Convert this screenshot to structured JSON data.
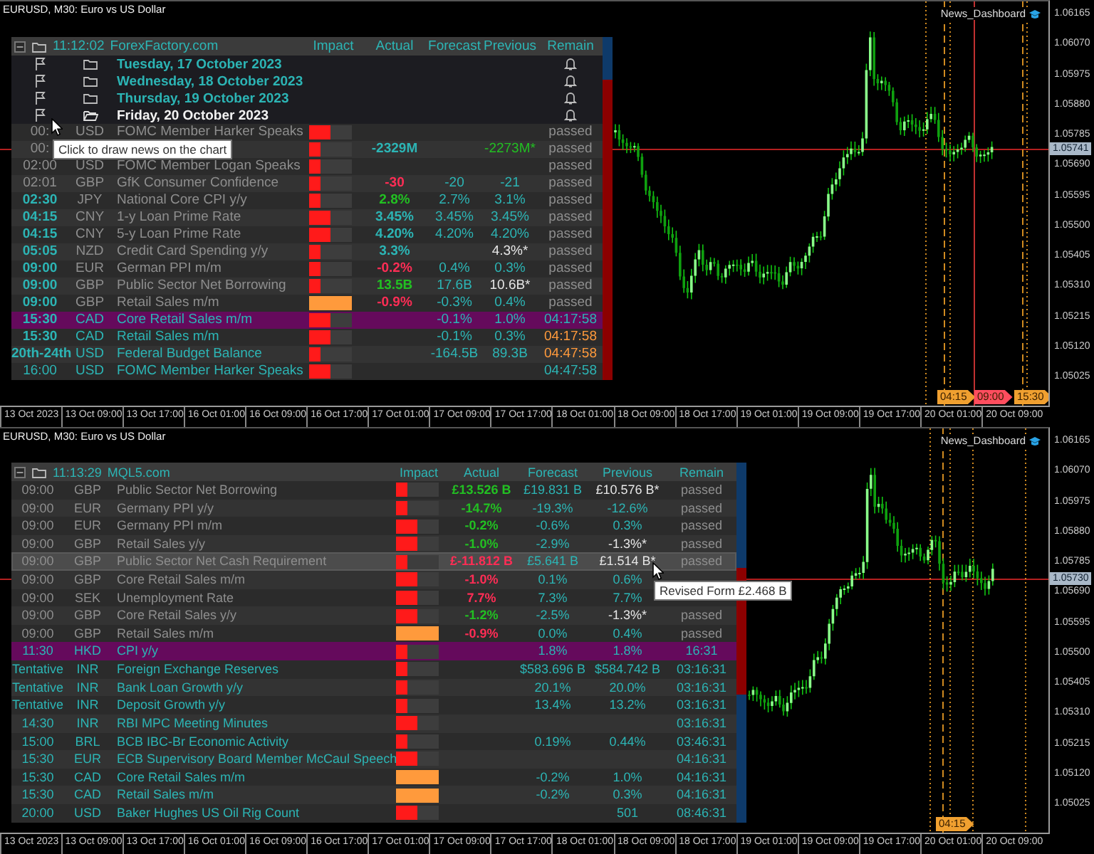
{
  "windows": [
    {
      "title": "EURUSD, M30: Euro vs US Dollar",
      "indicator": "News_Dashboard",
      "price_labels": [
        "1.06165",
        "1.06070",
        "1.05975",
        "1.05880",
        "1.05785",
        "1.05690",
        "1.05595",
        "1.05500",
        "1.05405",
        "1.05310",
        "1.05215",
        "1.05120",
        "1.05025"
      ],
      "current_price": "1.05741",
      "time_labels": [
        "13 Oct 2023",
        "13 Oct 09:00",
        "13 Oct 17:00",
        "16 Oct 01:00",
        "16 Oct 09:00",
        "16 Oct 17:00",
        "17 Oct 01:00",
        "17 Oct 09:00",
        "17 Oct 17:00",
        "18 Oct 01:00",
        "18 Oct 09:00",
        "18 Oct 17:00",
        "19 Oct 01:00",
        "19 Oct 09:00",
        "19 Oct 17:00",
        "20 Oct 01:00",
        "20 Oct 09:00"
      ],
      "event_tags": [
        {
          "label": "04:15",
          "color": "#f0a030"
        },
        {
          "label": "09:00",
          "color": "#ff4d5e"
        },
        {
          "label": "15:30",
          "color": "#f0a030"
        }
      ],
      "dashboard": {
        "collapse": "−",
        "time": "11:12:02",
        "source": "ForexFactory.com",
        "columns": [
          "Impact",
          "Actual",
          "Forecast",
          "Previous",
          "Remain"
        ],
        "days": [
          {
            "label": "Tuesday, 17 October 2023",
            "expanded": false
          },
          {
            "label": "Wednesday, 18 October 2023",
            "expanded": false
          },
          {
            "label": "Thursday, 19 October 2023",
            "expanded": false
          },
          {
            "label": "Friday, 20 October 2023",
            "expanded": true
          }
        ],
        "events": [
          {
            "time": "00:",
            "currency": "USD",
            "title": "FOMC Member Harker Speaks",
            "impact": {
              "level": 0.5,
              "color": "#ff1a1a"
            },
            "remain": {
              "text": "passed",
              "color": "#8e8e8e"
            },
            "passed": true,
            "time_bold": false,
            "highlighted": false,
            "hovered": false
          },
          {
            "time": "00:",
            "impact": {
              "level": 0.25,
              "color": "#ff1a1a"
            },
            "actual": {
              "text": "-2329M",
              "color": "#2cb5b5"
            },
            "previous": {
              "text": "-2273M*",
              "color": "#22c022"
            },
            "remain": {
              "text": "passed",
              "color": "#8e8e8e"
            },
            "passed": true,
            "time_bold": false,
            "highlighted": false,
            "hovered": false
          },
          {
            "time": "02:00",
            "currency": "USD",
            "title": "FOMC Member Logan Speaks",
            "impact": {
              "level": 0.25,
              "color": "#ff1a1a"
            },
            "remain": {
              "text": "passed",
              "color": "#8e8e8e"
            },
            "passed": true,
            "time_bold": false,
            "highlighted": false,
            "hovered": false
          },
          {
            "time": "02:01",
            "currency": "GBP",
            "title": "GfK Consumer Confidence",
            "impact": {
              "level": 0.25,
              "color": "#ff1a1a"
            },
            "actual": {
              "text": "-30",
              "color": "#ff2d55"
            },
            "forecast": {
              "text": "-20",
              "color": "#2cb5b5"
            },
            "previous": {
              "text": "-21",
              "color": "#2cb5b5"
            },
            "remain": {
              "text": "passed",
              "color": "#8e8e8e"
            },
            "passed": true,
            "time_bold": false,
            "highlighted": false,
            "hovered": false
          },
          {
            "time": "02:30",
            "currency": "JPY",
            "title": "National Core CPI y/y",
            "impact": {
              "level": 0.25,
              "color": "#ff1a1a"
            },
            "actual": {
              "text": "2.8%",
              "color": "#22c022"
            },
            "forecast": {
              "text": "2.7%",
              "color": "#2cb5b5"
            },
            "previous": {
              "text": "3.1%",
              "color": "#2cb5b5"
            },
            "remain": {
              "text": "passed",
              "color": "#8e8e8e"
            },
            "passed": true,
            "time_bold": true,
            "highlighted": false,
            "hovered": false
          },
          {
            "time": "04:15",
            "currency": "CNY",
            "title": "1-y Loan Prime Rate",
            "impact": {
              "level": 0.5,
              "color": "#ff1a1a"
            },
            "actual": {
              "text": "3.45%",
              "color": "#2cb5b5"
            },
            "forecast": {
              "text": "3.45%",
              "color": "#2cb5b5"
            },
            "previous": {
              "text": "3.45%",
              "color": "#2cb5b5"
            },
            "remain": {
              "text": "passed",
              "color": "#8e8e8e"
            },
            "passed": true,
            "time_bold": true,
            "highlighted": false,
            "hovered": false
          },
          {
            "time": "04:15",
            "currency": "CNY",
            "title": "5-y Loan Prime Rate",
            "impact": {
              "level": 0.5,
              "color": "#ff1a1a"
            },
            "actual": {
              "text": "4.20%",
              "color": "#2cb5b5"
            },
            "forecast": {
              "text": "4.20%",
              "color": "#2cb5b5"
            },
            "previous": {
              "text": "4.20%",
              "color": "#2cb5b5"
            },
            "remain": {
              "text": "passed",
              "color": "#8e8e8e"
            },
            "passed": true,
            "time_bold": true,
            "highlighted": false,
            "hovered": false
          },
          {
            "time": "05:05",
            "currency": "NZD",
            "title": "Credit Card Spending y/y",
            "impact": {
              "level": 0.25,
              "color": "#ff1a1a"
            },
            "actual": {
              "text": "3.3%",
              "color": "#2cb5b5"
            },
            "previous": {
              "text": "4.3%*",
              "color": "#e6e6e6"
            },
            "remain": {
              "text": "passed",
              "color": "#8e8e8e"
            },
            "passed": true,
            "time_bold": true,
            "highlighted": false,
            "hovered": false
          },
          {
            "time": "09:00",
            "currency": "EUR",
            "title": "German PPI m/m",
            "impact": {
              "level": 0.25,
              "color": "#ff1a1a"
            },
            "actual": {
              "text": "-0.2%",
              "color": "#ff2d55"
            },
            "forecast": {
              "text": "0.4%",
              "color": "#2cb5b5"
            },
            "previous": {
              "text": "0.3%",
              "color": "#2cb5b5"
            },
            "remain": {
              "text": "passed",
              "color": "#8e8e8e"
            },
            "passed": true,
            "time_bold": true,
            "highlighted": false,
            "hovered": false
          },
          {
            "time": "09:00",
            "currency": "GBP",
            "title": "Public Sector Net Borrowing",
            "impact": {
              "level": 0.25,
              "color": "#ff1a1a"
            },
            "actual": {
              "text": "13.5B",
              "color": "#22c022"
            },
            "forecast": {
              "text": "17.6B",
              "color": "#2cb5b5"
            },
            "previous": {
              "text": "10.6B*",
              "color": "#e6e6e6"
            },
            "remain": {
              "text": "passed",
              "color": "#8e8e8e"
            },
            "passed": true,
            "time_bold": true,
            "highlighted": false,
            "hovered": false
          },
          {
            "time": "09:00",
            "currency": "GBP",
            "title": "Retail Sales m/m",
            "impact": {
              "level": 1,
              "color": "#ff9a3c"
            },
            "actual": {
              "text": "-0.9%",
              "color": "#ff2d55"
            },
            "forecast": {
              "text": "-0.3%",
              "color": "#2cb5b5"
            },
            "previous": {
              "text": "0.4%",
              "color": "#2cb5b5"
            },
            "remain": {
              "text": "passed",
              "color": "#8e8e8e"
            },
            "passed": true,
            "time_bold": true,
            "highlighted": false,
            "hovered": false
          },
          {
            "time": "15:30",
            "currency": "CAD",
            "title": "Core Retail Sales m/m",
            "impact": {
              "level": 0.5,
              "color": "#ff1a1a"
            },
            "forecast": {
              "text": "-0.1%",
              "color": "#2cb5b5"
            },
            "previous": {
              "text": "1.0%",
              "color": "#2cb5b5"
            },
            "remain": {
              "text": "04:17:58",
              "color": "#2cb5b5"
            },
            "passed": false,
            "time_bold": true,
            "highlighted": true,
            "hovered": false
          },
          {
            "time": "15:30",
            "currency": "CAD",
            "title": "Retail Sales m/m",
            "impact": {
              "level": 0.5,
              "color": "#ff1a1a"
            },
            "forecast": {
              "text": "-0.1%",
              "color": "#2cb5b5"
            },
            "previous": {
              "text": "0.3%",
              "color": "#2cb5b5"
            },
            "remain": {
              "text": "04:17:58",
              "color": "#ff9a3c"
            },
            "passed": false,
            "time_bold": true,
            "highlighted": false,
            "hovered": false
          },
          {
            "time": "20th-24th",
            "currency": "USD",
            "title": "Federal Budget Balance",
            "impact": {
              "level": 0.25,
              "color": "#ff1a1a"
            },
            "forecast": {
              "text": "-164.5B",
              "color": "#2cb5b5"
            },
            "previous": {
              "text": "89.3B",
              "color": "#2cb5b5"
            },
            "remain": {
              "text": "04:47:58",
              "color": "#ff9a3c"
            },
            "passed": false,
            "time_bold": true,
            "highlighted": false,
            "hovered": false
          },
          {
            "time": "16:00",
            "currency": "USD",
            "title": "FOMC Member Harker Speaks",
            "impact": {
              "level": 0.5,
              "color": "#ff1a1a"
            },
            "remain": {
              "text": "04:47:58",
              "color": "#2cb5b5"
            },
            "passed": false,
            "time_bold": false,
            "highlighted": false,
            "hovered": false
          }
        ],
        "tooltip": "Click to draw news on the chart"
      }
    },
    {
      "title": "EURUSD, M30: Euro vs US Dollar",
      "indicator": "News_Dashboard",
      "price_labels": [
        "1.06165",
        "1.06070",
        "1.05975",
        "1.05880",
        "1.05785",
        "1.05690",
        "1.05595",
        "1.05500",
        "1.05405",
        "1.05310",
        "1.05215",
        "1.05120",
        "1.05025"
      ],
      "current_price": "1.05730",
      "time_labels": [
        "13 Oct 2023",
        "13 Oct 09:00",
        "13 Oct 17:00",
        "16 Oct 01:00",
        "16 Oct 09:00",
        "16 Oct 17:00",
        "17 Oct 01:00",
        "17 Oct 09:00",
        "17 Oct 17:00",
        "18 Oct 01:00",
        "18 Oct 09:00",
        "18 Oct 17:00",
        "19 Oct 01:00",
        "19 Oct 09:00",
        "19 Oct 17:00",
        "20 Oct 01:00",
        "20 Oct 09:00"
      ],
      "event_tags": [
        {
          "label": "04:15",
          "color": "#f0a030"
        }
      ],
      "dashboard": {
        "collapse": "−",
        "time": "11:13:29",
        "source": "MQL5.com",
        "columns": [
          "Impact",
          "Actual",
          "Forecast",
          "Previous",
          "Remain"
        ],
        "events": [
          {
            "time": "09:00",
            "currency": "GBP",
            "title": "Public Sector Net Borrowing",
            "impact": {
              "level": 0.25,
              "color": "#ff1a1a"
            },
            "actual": {
              "text": "£13.526 B",
              "color": "#22c022"
            },
            "forecast": {
              "text": "£19.831 B",
              "color": "#2cb5b5"
            },
            "previous": {
              "text": "£10.576 B*",
              "color": "#e6e6e6"
            },
            "remain": {
              "text": "passed",
              "color": "#8e8e8e"
            },
            "passed": true,
            "time_bold": false,
            "highlighted": false,
            "hovered": false
          },
          {
            "time": "09:00",
            "currency": "EUR",
            "title": "Germany PPI y/y",
            "impact": {
              "level": 0.25,
              "color": "#ff1a1a"
            },
            "actual": {
              "text": "-14.7%",
              "color": "#22c022"
            },
            "forecast": {
              "text": "-19.3%",
              "color": "#2cb5b5"
            },
            "previous": {
              "text": "-12.6%",
              "color": "#2cb5b5"
            },
            "remain": {
              "text": "passed",
              "color": "#8e8e8e"
            },
            "passed": true,
            "time_bold": false,
            "highlighted": false,
            "hovered": false
          },
          {
            "time": "09:00",
            "currency": "EUR",
            "title": "Germany PPI m/m",
            "impact": {
              "level": 0.5,
              "color": "#ff1a1a"
            },
            "actual": {
              "text": "-0.2%",
              "color": "#22c022"
            },
            "forecast": {
              "text": "-0.6%",
              "color": "#2cb5b5"
            },
            "previous": {
              "text": "0.3%",
              "color": "#2cb5b5"
            },
            "remain": {
              "text": "passed",
              "color": "#8e8e8e"
            },
            "passed": true,
            "time_bold": false,
            "highlighted": false,
            "hovered": false
          },
          {
            "time": "09:00",
            "currency": "GBP",
            "title": "Retail Sales y/y",
            "impact": {
              "level": 0.5,
              "color": "#ff1a1a"
            },
            "actual": {
              "text": "-1.0%",
              "color": "#22c022"
            },
            "forecast": {
              "text": "-2.9%",
              "color": "#2cb5b5"
            },
            "previous": {
              "text": "-1.3%*",
              "color": "#e6e6e6"
            },
            "remain": {
              "text": "passed",
              "color": "#8e8e8e"
            },
            "passed": true,
            "time_bold": false,
            "highlighted": false,
            "hovered": false
          },
          {
            "time": "09:00",
            "currency": "GBP",
            "title": "Public Sector Net Cash Requirement",
            "impact": {
              "level": 0.25,
              "color": "#ff1a1a"
            },
            "actual": {
              "text": "£-11.812 B",
              "color": "#ff2d55"
            },
            "forecast": {
              "text": "£5.641 B",
              "color": "#2cb5b5"
            },
            "previous": {
              "text": "£1.514 B*",
              "color": "#e6e6e6"
            },
            "remain": {
              "text": "passed",
              "color": "#8e8e8e"
            },
            "passed": true,
            "time_bold": false,
            "highlighted": false,
            "hovered": true
          },
          {
            "time": "09:00",
            "currency": "GBP",
            "title": "Core Retail Sales m/m",
            "impact": {
              "level": 0.5,
              "color": "#ff1a1a"
            },
            "actual": {
              "text": "-1.0%",
              "color": "#ff2d55"
            },
            "forecast": {
              "text": "0.1%",
              "color": "#2cb5b5"
            },
            "previous": {
              "text": "0.6%",
              "color": "#2cb5b5"
            },
            "passed": true,
            "time_bold": false,
            "highlighted": false,
            "hovered": false
          },
          {
            "time": "09:00",
            "currency": "SEK",
            "title": "Unemployment Rate",
            "impact": {
              "level": 0.5,
              "color": "#ff1a1a"
            },
            "actual": {
              "text": "7.7%",
              "color": "#ff2d55"
            },
            "forecast": {
              "text": "7.3%",
              "color": "#2cb5b5"
            },
            "previous": {
              "text": "7.7%",
              "color": "#2cb5b5"
            },
            "passed": true,
            "time_bold": false,
            "highlighted": false,
            "hovered": false
          },
          {
            "time": "09:00",
            "currency": "GBP",
            "title": "Core Retail Sales y/y",
            "impact": {
              "level": 0.5,
              "color": "#ff1a1a"
            },
            "actual": {
              "text": "-1.2%",
              "color": "#22c022"
            },
            "forecast": {
              "text": "-2.5%",
              "color": "#2cb5b5"
            },
            "previous": {
              "text": "-1.3%*",
              "color": "#e6e6e6"
            },
            "remain": {
              "text": "passed",
              "color": "#8e8e8e"
            },
            "passed": true,
            "time_bold": false,
            "highlighted": false,
            "hovered": false
          },
          {
            "time": "09:00",
            "currency": "GBP",
            "title": "Retail Sales m/m",
            "impact": {
              "level": 1,
              "color": "#ff9a3c"
            },
            "actual": {
              "text": "-0.9%",
              "color": "#ff2d55"
            },
            "forecast": {
              "text": "0.0%",
              "color": "#2cb5b5"
            },
            "previous": {
              "text": "0.4%",
              "color": "#2cb5b5"
            },
            "remain": {
              "text": "passed",
              "color": "#8e8e8e"
            },
            "passed": true,
            "time_bold": false,
            "highlighted": false,
            "hovered": false
          },
          {
            "time": "11:30",
            "currency": "HKD",
            "title": "CPI y/y",
            "impact": {
              "level": 0.25,
              "color": "#ff1a1a"
            },
            "forecast": {
              "text": "1.8%",
              "color": "#2cb5b5"
            },
            "previous": {
              "text": "1.8%",
              "color": "#2cb5b5"
            },
            "remain": {
              "text": "16:31",
              "color": "#2cb5b5"
            },
            "passed": false,
            "time_bold": false,
            "highlighted": true,
            "hovered": false
          },
          {
            "time": "Tentative",
            "currency": "INR",
            "title": "Foreign Exchange Reserves",
            "impact": {
              "level": 0.25,
              "color": "#ff1a1a"
            },
            "forecast": {
              "text": "$583.696 B",
              "color": "#2cb5b5"
            },
            "previous": {
              "text": "$584.742 B",
              "color": "#2cb5b5"
            },
            "remain": {
              "text": "03:16:31",
              "color": "#2cb5b5"
            },
            "passed": false,
            "time_bold": false,
            "highlighted": false,
            "hovered": false
          },
          {
            "time": "Tentative",
            "currency": "INR",
            "title": "Bank Loan Growth y/y",
            "impact": {
              "level": 0.25,
              "color": "#ff1a1a"
            },
            "forecast": {
              "text": "20.1%",
              "color": "#2cb5b5"
            },
            "previous": {
              "text": "20.0%",
              "color": "#2cb5b5"
            },
            "remain": {
              "text": "03:16:31",
              "color": "#2cb5b5"
            },
            "passed": false,
            "time_bold": false,
            "highlighted": false,
            "hovered": false
          },
          {
            "time": "Tentative",
            "currency": "INR",
            "title": "Deposit Growth y/y",
            "impact": {
              "level": 0.25,
              "color": "#ff1a1a"
            },
            "forecast": {
              "text": "13.4%",
              "color": "#2cb5b5"
            },
            "previous": {
              "text": "13.2%",
              "color": "#2cb5b5"
            },
            "remain": {
              "text": "03:16:31",
              "color": "#2cb5b5"
            },
            "passed": false,
            "time_bold": false,
            "highlighted": false,
            "hovered": false
          },
          {
            "time": "14:30",
            "currency": "INR",
            "title": "RBI MPC Meeting Minutes",
            "impact": {
              "level": 0.5,
              "color": "#ff1a1a"
            },
            "remain": {
              "text": "03:16:31",
              "color": "#2cb5b5"
            },
            "passed": false,
            "time_bold": false,
            "highlighted": false,
            "hovered": false
          },
          {
            "time": "15:00",
            "currency": "BRL",
            "title": "BCB IBC-Br Economic Activity",
            "impact": {
              "level": 0.25,
              "color": "#ff1a1a"
            },
            "forecast": {
              "text": "0.19%",
              "color": "#2cb5b5"
            },
            "previous": {
              "text": "0.44%",
              "color": "#2cb5b5"
            },
            "remain": {
              "text": "03:46:31",
              "color": "#2cb5b5"
            },
            "passed": false,
            "time_bold": false,
            "highlighted": false,
            "hovered": false
          },
          {
            "time": "15:30",
            "currency": "EUR",
            "title": "ECB Supervisory Board Member McCaul Speech",
            "impact": {
              "level": 0.5,
              "color": "#ff1a1a"
            },
            "remain": {
              "text": "04:16:31",
              "color": "#2cb5b5"
            },
            "passed": false,
            "time_bold": false,
            "highlighted": false,
            "hovered": false
          },
          {
            "time": "15:30",
            "currency": "CAD",
            "title": "Core Retail Sales m/m",
            "impact": {
              "level": 1,
              "color": "#ff9a3c"
            },
            "forecast": {
              "text": "-0.2%",
              "color": "#2cb5b5"
            },
            "previous": {
              "text": "1.0%",
              "color": "#2cb5b5"
            },
            "remain": {
              "text": "04:16:31",
              "color": "#2cb5b5"
            },
            "passed": false,
            "time_bold": false,
            "highlighted": false,
            "hovered": false
          },
          {
            "time": "15:30",
            "currency": "CAD",
            "title": "Retail Sales m/m",
            "impact": {
              "level": 1,
              "color": "#ff9a3c"
            },
            "forecast": {
              "text": "-0.2%",
              "color": "#2cb5b5"
            },
            "previous": {
              "text": "0.3%",
              "color": "#2cb5b5"
            },
            "remain": {
              "text": "04:16:31",
              "color": "#2cb5b5"
            },
            "passed": false,
            "time_bold": false,
            "highlighted": false,
            "hovered": false
          },
          {
            "time": "20:00",
            "currency": "USD",
            "title": "Baker Hughes US Oil Rig Count",
            "impact": {
              "level": 0.5,
              "color": "#ff1a1a"
            },
            "previous": {
              "text": "501",
              "color": "#2cb5b5"
            },
            "remain": {
              "text": "08:46:31",
              "color": "#2cb5b5"
            },
            "passed": false,
            "time_bold": false,
            "highlighted": false,
            "hovered": false
          }
        ],
        "tooltip": "Revised Form £2.468 B"
      }
    }
  ]
}
